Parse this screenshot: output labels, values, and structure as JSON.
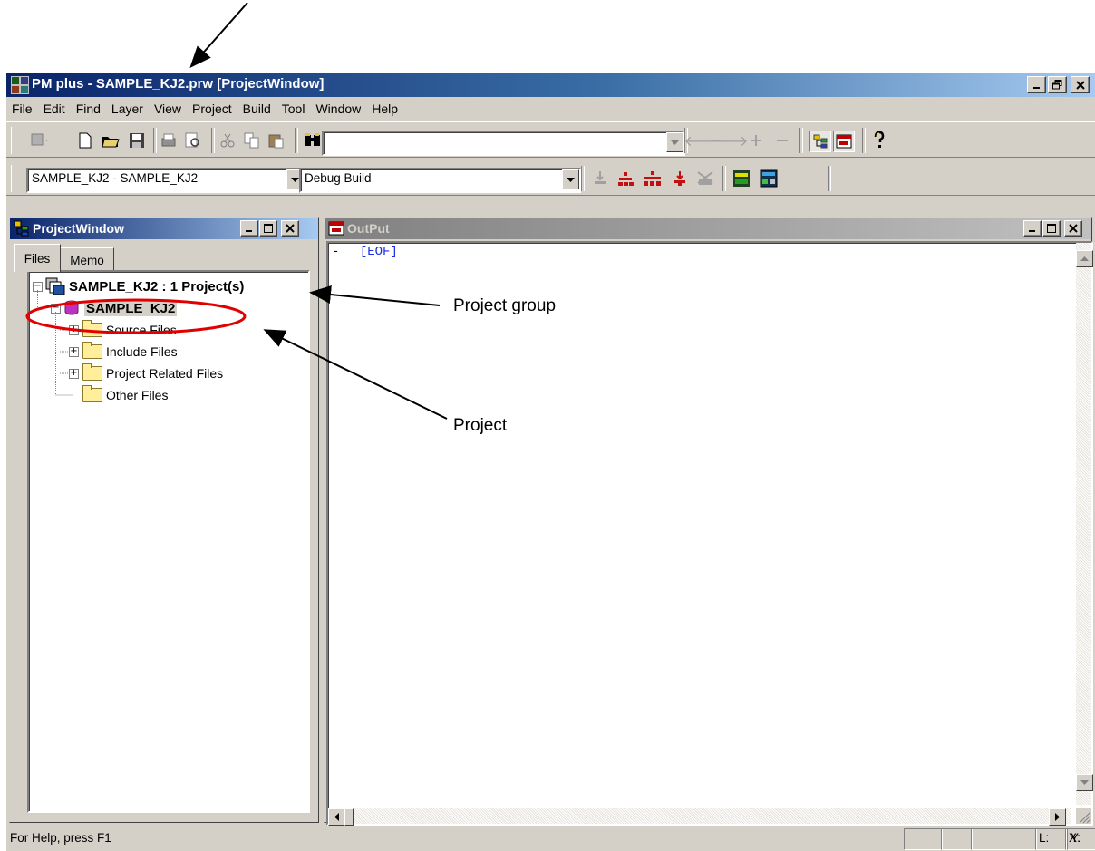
{
  "window": {
    "title": "PM plus - SAMPLE_KJ2.prw [ProjectWindow]",
    "minimize_glyph": "_",
    "restore_glyph": "❐",
    "close_glyph": "✕"
  },
  "menu": [
    "File",
    "Edit",
    "Find",
    "Layer",
    "View",
    "Project",
    "Build",
    "Tool",
    "Window",
    "Help"
  ],
  "toolbar2": {
    "project_combo": "SAMPLE_KJ2 - SAMPLE_KJ2",
    "build_combo": "Debug Build"
  },
  "project_window": {
    "title": "ProjectWindow",
    "tabs": [
      "Files",
      "Memo"
    ],
    "tree": {
      "group_label": "SAMPLE_KJ2 : 1 Project(s)",
      "project_label": "SAMPLE_KJ2",
      "folders": [
        "Source Files",
        "Include Files",
        "Project Related Files",
        "Other Files"
      ]
    }
  },
  "output_window": {
    "title": "OutPut",
    "line_prefix": "-",
    "line_text": "[EOF]"
  },
  "status": {
    "help_text": "For Help, press F1",
    "panels": [
      "",
      "",
      "",
      "L:",
      "X:",
      "Y:"
    ]
  },
  "annotations": {
    "project_group": "Project group",
    "project": "Project"
  },
  "colors": {
    "title_active": "#0a246a",
    "title_inactive": "#808080",
    "highlight_circle": "#e00000",
    "eof_text": "#1a2ee6"
  }
}
